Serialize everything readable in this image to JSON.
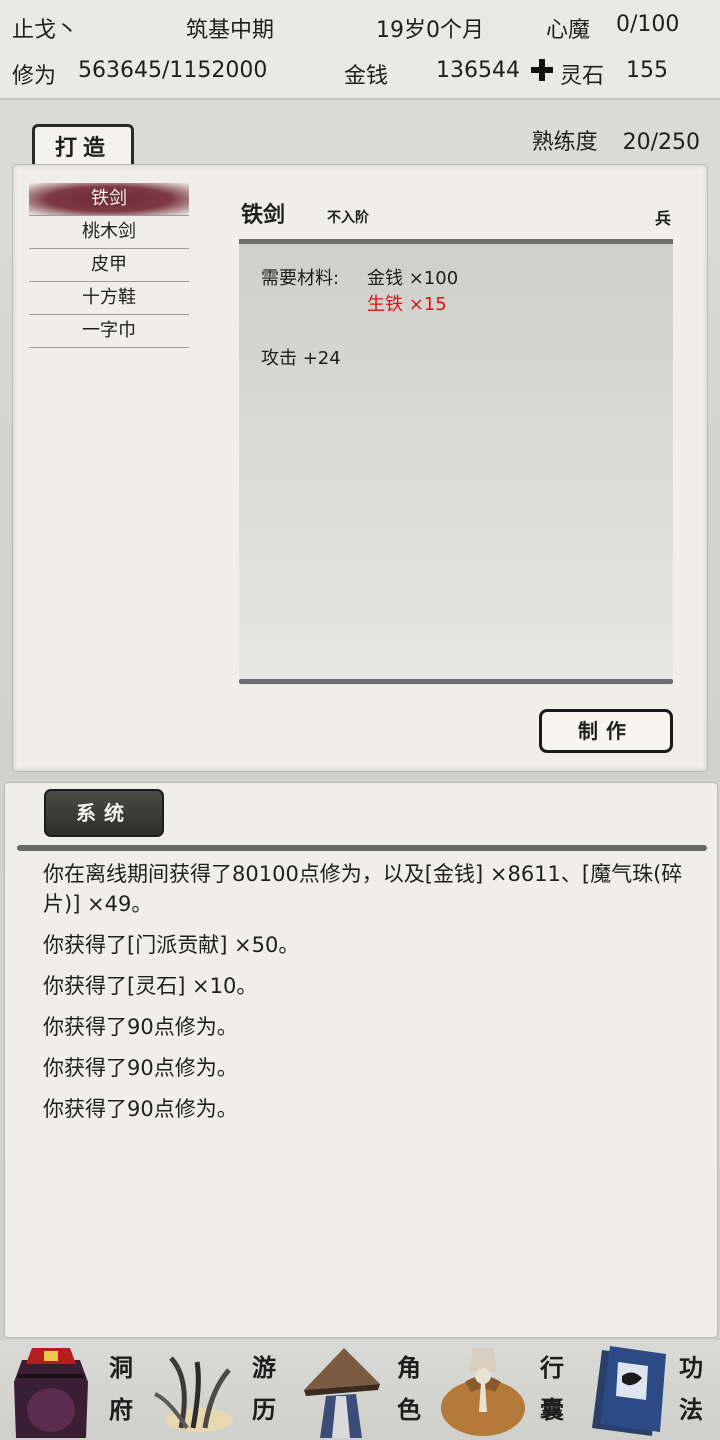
{
  "header": {
    "name": "止戈丶",
    "realm": "筑基中期",
    "age": "19岁0个月",
    "demon_label": "心魔",
    "demon_value": "0/100",
    "cultivation_label": "修为",
    "cultivation_value": "563645/1152000",
    "money_label": "金钱",
    "money_value": "136544",
    "stone_label": "灵石",
    "stone_value": "155"
  },
  "craft": {
    "tab_label": "打造",
    "proficiency_label": "熟练度",
    "proficiency_value": "20/250",
    "items": [
      {
        "label": "铁剑",
        "selected": true
      },
      {
        "label": "桃木剑"
      },
      {
        "label": "皮甲"
      },
      {
        "label": "十方鞋"
      },
      {
        "label": "一字巾"
      }
    ],
    "detail": {
      "name": "铁剑",
      "grade": "不入阶",
      "type": "兵",
      "materials_label": "需要材料:",
      "material_1": "金钱 ×100",
      "material_2": "生铁 ×15",
      "material_2_color": "#e01414",
      "stat": "攻击 +24"
    },
    "make_button": "制作"
  },
  "log": {
    "tab_label": "系统",
    "lines": [
      "你在离线期间获得了80100点修为，以及[金钱] ×8611、[魔气珠(碎片)] ×49。",
      "你获得了[门派贡献] ×50。",
      "你获得了[灵石] ×10。",
      "你获得了90点修为。",
      "你获得了90点修为。",
      "你获得了90点修为。"
    ]
  },
  "nav": {
    "cave_1": "洞",
    "cave_2": "府",
    "travel_1": "游",
    "travel_2": "历",
    "role_1": "角",
    "role_2": "色",
    "bag_1": "行",
    "bag_2": "囊",
    "skill_1": "功",
    "skill_2": "法"
  },
  "colors": {
    "selected_item": "#7d3a43",
    "warning_text": "#e01414",
    "panel_bg": "#efeee9"
  }
}
